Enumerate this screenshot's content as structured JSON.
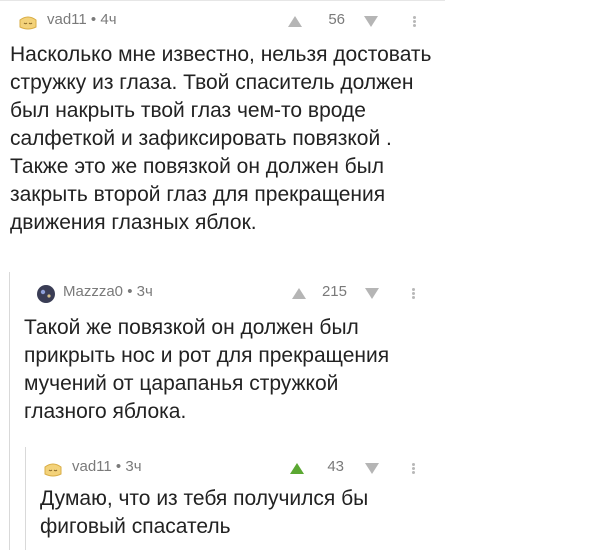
{
  "comments": [
    {
      "author": "vad11",
      "meta": " • 4ч",
      "rating": "56",
      "text": "Насколько мне известно, нельзя достовать стружку из глаза. Твой спаситель должен был накрыть твой глаз чем-то вроде салфеткой и зафиксировать повязкой . Также это же повязкой он должен был закрыть второй глаз для прекращения движения глазных яблок."
    },
    {
      "author": "Mazzza0",
      "meta": " • 3ч",
      "rating": "215",
      "text": "Такой же повязкой он должен был прикрыть нос и рот для прекращения мучений от царапанья стружкой глазного яблока."
    },
    {
      "author": "vad11",
      "meta": " • 3ч",
      "rating": "43",
      "text": "Думаю, что из тебя получился бы фиговый спасатель"
    }
  ],
  "colors": {
    "upvoted": "#5ba832",
    "vote_neutral": "#b5b5b5",
    "meta_text": "#7a7a7a",
    "avatar_default": "#f3d27a",
    "avatar_mazzza0": "#3a3d55"
  },
  "icons": {
    "avatar_default": "sleeping-face-icon",
    "vote_up": "triangle-up-icon",
    "vote_down": "triangle-down-icon",
    "more": "vertical-dots-icon"
  }
}
